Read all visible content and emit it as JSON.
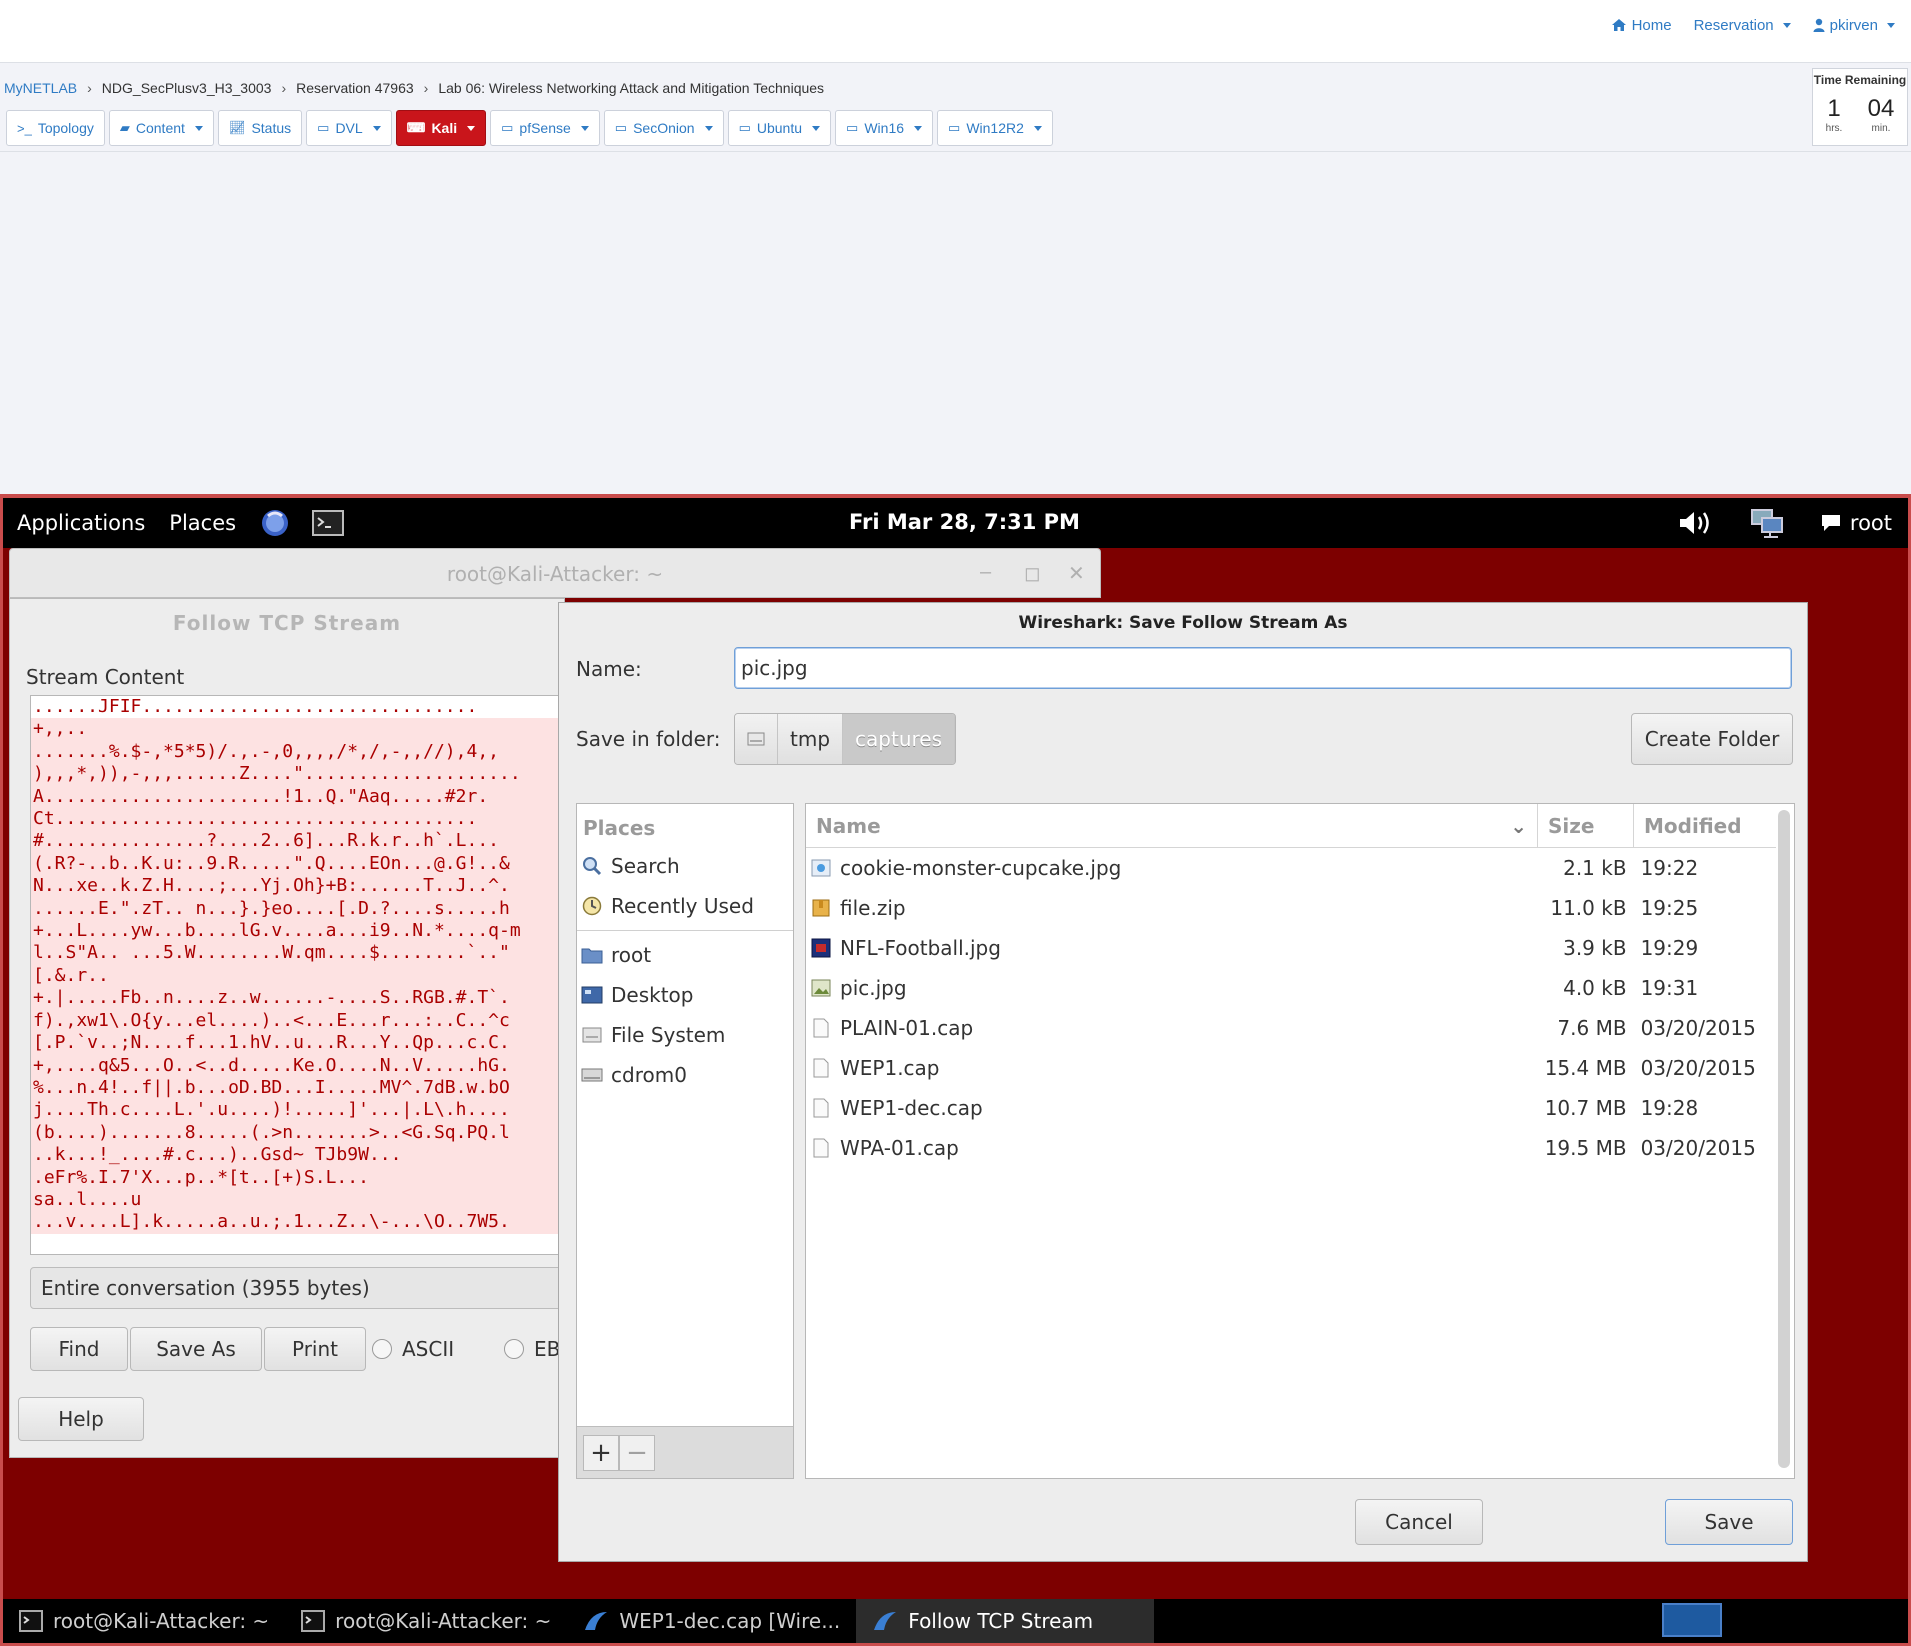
{
  "topnav": {
    "home": "Home",
    "reservation": "Reservation",
    "user": "pkirven"
  },
  "breadcrumb": [
    "MyNETLAB",
    "NDG_SecPlusv3_H3_3003",
    "Reservation 47963",
    "Lab 06: Wireless Networking Attack and Mitigation Techniques"
  ],
  "toolbar": {
    "topology": "Topology",
    "content": "Content",
    "status": "Status",
    "dvl": "DVL",
    "kali": "Kali",
    "pfsense": "pfSense",
    "seconion": "SecOnion",
    "ubuntu": "Ubuntu",
    "win16": "Win16",
    "win12r2": "Win12R2"
  },
  "time_remaining": {
    "title": "Time Remaining",
    "hours": "1",
    "hours_unit": "hrs.",
    "minutes": "04",
    "minutes_unit": "min."
  },
  "gnome": {
    "applications": "Applications",
    "places": "Places",
    "clock": "Fri Mar 28,  7:31 PM",
    "user": "root"
  },
  "terminal_title": "root@Kali-Attacker: ~",
  "follow": {
    "title": "Follow TCP Stream",
    "stream_label": "Stream Content",
    "lines": [
      "......JFIF...............................",
      "+,,..",
      "",
      ".......%.$-,*5*5)/.,.-,0,,,,/*,/,-,,//),4,,",
      "),,,*,)),-,,,......Z....\"....................",
      "A......................!1..Q.\"Aaq.....#2r.",
      "Ct.......................................",
      "#...............?....2..6]...R.k.r..h`.L...",
      "(.R?-..b..K.u:..9.R.....\".Q....EOn...@.G!..&",
      "N...xe..k.Z.H....;...Yj.Oh}+B:......T..J..^.",
      "......E.\".zT.. n...}.}eo....[.D.?....s.....h",
      "+...L....yw...b....lG.v....a...i9..N.*....q-m",
      "l..S\"A.. ...5.W........W.qm....$........`..\"",
      "[.&.r..",
      "+.|.....Fb..n....z..w......-....S..RGB.#.T`.",
      "f).,xw1\\.O{y...el....)..<...E...r...:..C..^c",
      "[.P.`v..;N....f...1.hV..u...R...Y..Qp...c.C.",
      "+,....q&5...O..<..d.....Ke.O....N..V.....hG.",
      "%...n.4!..f||.b...oD.BD...I.....MV^.7dB.w.bO",
      "j....Th.c....L.'.u....)!.....]'...|.L\\.h....",
      "(b....).......8.....(.>n.......>..<G.Sq.PQ.l",
      "..k...!_....#.c...)..Gsd~ TJb9W...",
      ".eFr%.I.7'X...p..*[t..[+)S.L...",
      "sa..l....u",
      "...v....L].k.....a..u.;.1...Z..\\-...\\O..7W5."
    ],
    "conversation": "Entire conversation (3955 bytes)",
    "find": "Find",
    "save_as": "Save As",
    "print": "Print",
    "ascii": "ASCII",
    "ebcdic": "EBCDIC",
    "help": "Help"
  },
  "save_dialog": {
    "title": "Wireshark: Save Follow Stream As",
    "name_label": "Name:",
    "name_value": "pic.jpg",
    "folder_label": "Save in folder:",
    "path": [
      "tmp",
      "captures"
    ],
    "create_folder": "Create Folder",
    "places_header": "Places",
    "places": [
      {
        "label": "Search",
        "icon": "search-icon"
      },
      {
        "label": "Recently Used",
        "icon": "recent-icon"
      },
      {
        "label": "root",
        "icon": "home-folder-icon"
      },
      {
        "label": "Desktop",
        "icon": "desktop-icon"
      },
      {
        "label": "File System",
        "icon": "filesystem-icon"
      },
      {
        "label": "cdrom0",
        "icon": "cdrom-icon"
      }
    ],
    "columns": {
      "name": "Name",
      "size": "Size",
      "modified": "Modified"
    },
    "files": [
      {
        "name": "cookie-monster-cupcake.jpg",
        "size": "2.1 kB",
        "modified": "19:22",
        "icon": "image-icon"
      },
      {
        "name": "file.zip",
        "size": "11.0 kB",
        "modified": "19:25",
        "icon": "archive-icon"
      },
      {
        "name": "NFL-Football.jpg",
        "size": "3.9 kB",
        "modified": "19:29",
        "icon": "image-icon"
      },
      {
        "name": "pic.jpg",
        "size": "4.0 kB",
        "modified": "19:31",
        "icon": "image-icon"
      },
      {
        "name": "PLAIN-01.cap",
        "size": "7.6 MB",
        "modified": "03/20/2015",
        "icon": "document-icon"
      },
      {
        "name": "WEP1.cap",
        "size": "15.4 MB",
        "modified": "03/20/2015",
        "icon": "document-icon"
      },
      {
        "name": "WEP1-dec.cap",
        "size": "10.7 MB",
        "modified": "19:28",
        "icon": "document-icon"
      },
      {
        "name": "WPA-01.cap",
        "size": "19.5 MB",
        "modified": "03/20/2015",
        "icon": "document-icon"
      }
    ],
    "cancel": "Cancel",
    "save": "Save"
  },
  "taskbar": [
    {
      "label": "root@Kali-Attacker: ~",
      "icon": "terminal-icon"
    },
    {
      "label": "root@Kali-Attacker: ~",
      "icon": "terminal-icon"
    },
    {
      "label": "WEP1-dec.cap  [Wire...",
      "icon": "wireshark-icon"
    },
    {
      "label": "Follow TCP Stream",
      "icon": "wireshark-icon"
    }
  ],
  "colors": {
    "netlab_blue": "#2f7bc4",
    "kali_red": "#c9151b",
    "desktop_bg": "#7d0000"
  }
}
